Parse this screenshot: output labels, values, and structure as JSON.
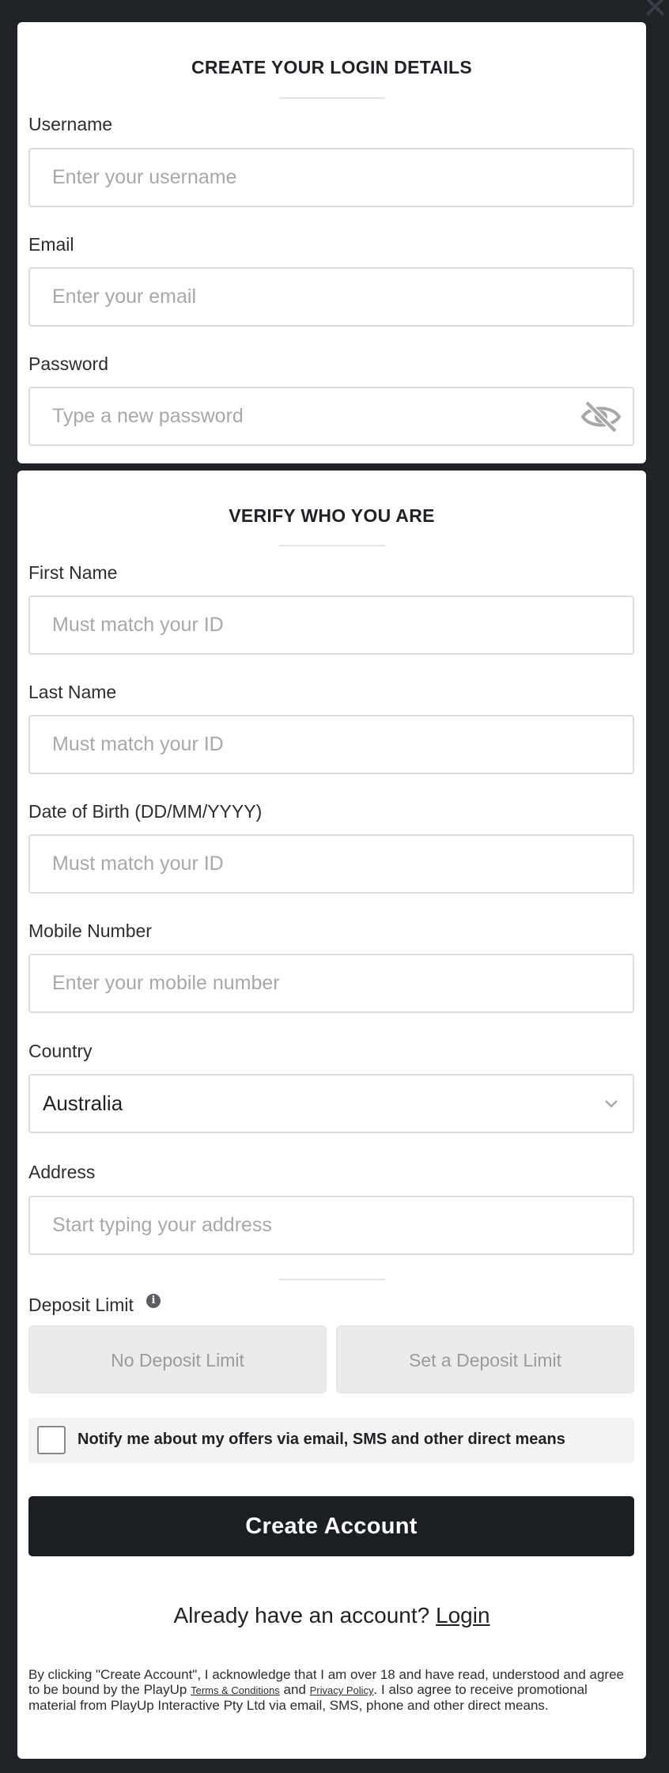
{
  "close": {
    "glyph": "✕"
  },
  "login_section": {
    "title": "CREATE YOUR LOGIN DETAILS",
    "username": {
      "label": "Username",
      "placeholder": "Enter your username",
      "value": ""
    },
    "email": {
      "label": "Email",
      "placeholder": "Enter your email",
      "value": ""
    },
    "password": {
      "label": "Password",
      "placeholder": "Type a new password",
      "value": "",
      "toggle_icon": "eye-hidden-icon"
    }
  },
  "verify_section": {
    "title": "VERIFY WHO YOU ARE",
    "first_name": {
      "label": "First Name",
      "placeholder": "Must match your ID",
      "value": ""
    },
    "last_name": {
      "label": "Last Name",
      "placeholder": "Must match your ID",
      "value": ""
    },
    "dob": {
      "label": "Date of Birth (DD/MM/YYYY)",
      "placeholder": "Must match your ID",
      "value": ""
    },
    "mobile": {
      "label": "Mobile Number",
      "placeholder": "Enter your mobile number",
      "value": ""
    },
    "country": {
      "label": "Country",
      "value": "Australia"
    },
    "address": {
      "label": "Address",
      "placeholder": "Start typing your address",
      "value": ""
    },
    "deposit_limit": {
      "label": "Deposit Limit",
      "info_glyph": "i",
      "options": [
        "No Deposit Limit",
        "Set a Deposit Limit"
      ]
    },
    "notify": {
      "label": "Notify me about my offers via email, SMS and other direct means",
      "checked": false
    },
    "create_button": "Create Account",
    "login_prompt": "Already have an account?",
    "login_link": "Login",
    "legal": {
      "part1": "By clicking \"Create Account\", I acknowledge that I am over 18 and have read, understood and agree to be bound by the PlayUp ",
      "terms_link": "Terms & Conditions",
      "part2": " and ",
      "privacy_link": "Privacy Policy",
      "part3": ". I also agree to receive promotional material from PlayUp Interactive Pty Ltd via email, SMS, phone and other direct means."
    }
  },
  "colors": {
    "background": "#1f2226",
    "card": "#ffffff",
    "primary_button": "#1b1e22",
    "placeholder": "#a8a8a8"
  }
}
